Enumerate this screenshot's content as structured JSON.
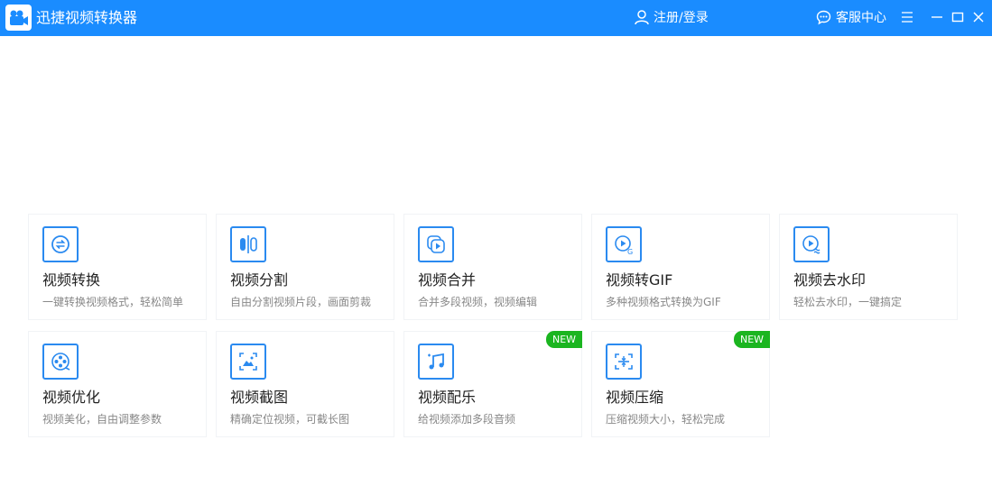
{
  "app": {
    "title": "迅捷视频转换器"
  },
  "header": {
    "login_label": "注册/登录",
    "service_label": "客服中心"
  },
  "colors": {
    "titlebar": "#1a8cff",
    "icon_blue": "#2a8af0",
    "badge_green": "#1bb520"
  },
  "tools": [
    {
      "title": "视频转换",
      "desc": "一键转换视频格式，轻松简单",
      "icon": "convert-icon"
    },
    {
      "title": "视频分割",
      "desc": "自由分割视频片段，画面剪裁",
      "icon": "split-icon"
    },
    {
      "title": "视频合并",
      "desc": "合并多段视频，视频编辑",
      "icon": "merge-icon"
    },
    {
      "title": "视频转GIF",
      "desc": "多种视频格式转换为GIF",
      "icon": "gif-icon"
    },
    {
      "title": "视频去水印",
      "desc": "轻松去水印，一键搞定",
      "icon": "watermark-icon"
    },
    {
      "title": "视频优化",
      "desc": "视频美化，自由调整参数",
      "icon": "film-reel-icon"
    },
    {
      "title": "视频截图",
      "desc": "精确定位视频，可截长图",
      "icon": "screenshot-icon"
    },
    {
      "title": "视频配乐",
      "desc": "给视频添加多段音频",
      "icon": "music-note-icon",
      "badge": "NEW"
    },
    {
      "title": "视频压缩",
      "desc": "压缩视频大小，轻松完成",
      "icon": "compress-icon",
      "badge": "NEW"
    }
  ]
}
